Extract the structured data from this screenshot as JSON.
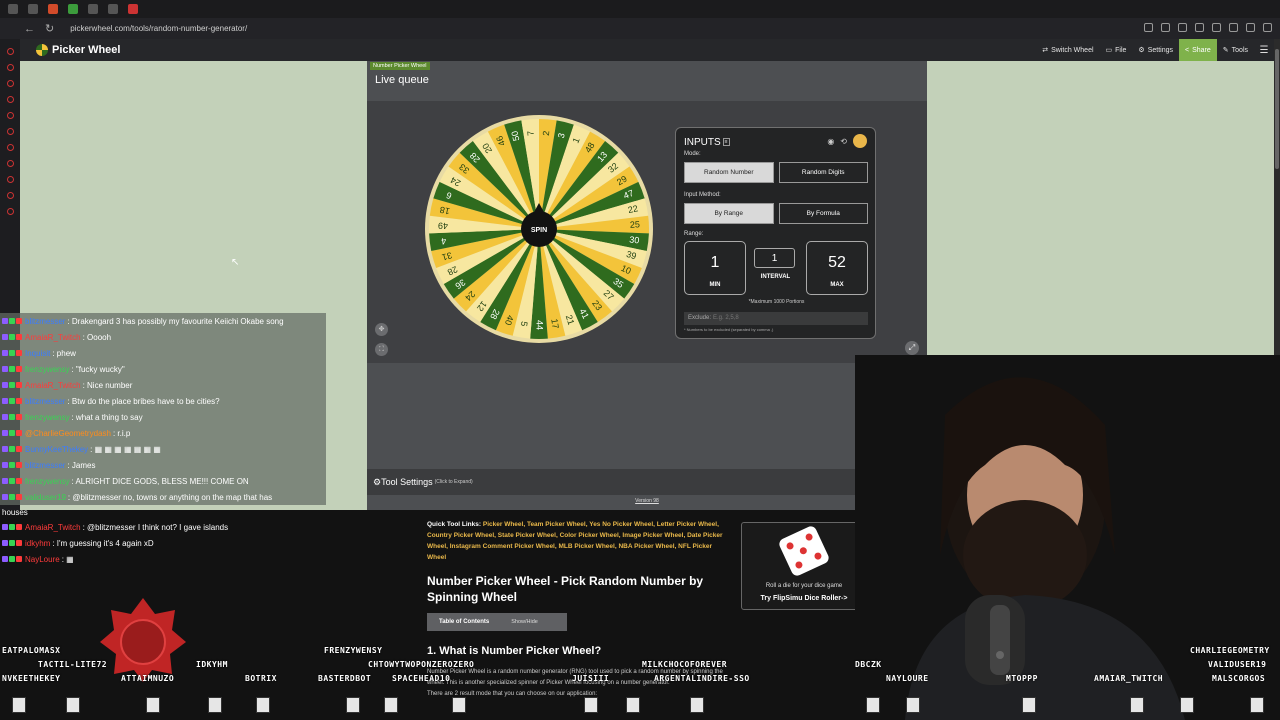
{
  "browser": {
    "url": "pickerwheel.com/tools/random-number-generator/",
    "back": "←",
    "reload": "↻"
  },
  "header": {
    "brand": "Picker Wheel",
    "nav": [
      "Switch Wheel",
      "File",
      "Settings",
      "Share",
      "Tools"
    ],
    "menu_icon": "☰"
  },
  "tool": {
    "tag": "Number Picker Wheel",
    "title": "Live queue",
    "spin_label": "SPIN",
    "wheel_numbers": [
      "2",
      "3",
      "1",
      "48",
      "13",
      "32",
      "29",
      "47",
      "22",
      "25",
      "30",
      "39",
      "10",
      "35",
      "27",
      "23",
      "41",
      "21",
      "17",
      "44",
      "5",
      "40",
      "28",
      "12",
      "24",
      "36",
      "28",
      "31",
      "4",
      "49",
      "18",
      "6",
      "24",
      "33",
      "28",
      "20",
      "46",
      "50",
      "7"
    ],
    "inputs": {
      "title": "INPUTS",
      "mode_label": "Mode:",
      "mode_options": [
        "Random Number",
        "Random Digits"
      ],
      "method_label": "Input Method:",
      "method_options": [
        "By Range",
        "By Formula"
      ],
      "range_label": "Range:",
      "min": "1",
      "min_caption": "MIN",
      "interval": "1",
      "interval_caption": "INTERVAL",
      "max": "52",
      "max_caption": "MAX",
      "max_note": "*Maximum 1000 Portions",
      "exclude_label": "Exclude:",
      "exclude_placeholder": "E.g. 2,5,8",
      "exclude_note": "* Numbers to be excluded (separated by comma ,)"
    },
    "settings_label": "Tool Settings",
    "settings_hint": "(Click to Expand)",
    "version": "Version 98"
  },
  "chat": [
    {
      "user": "blitzmesser",
      "color": "#3b7cff",
      "text": ": Drakengard 3 has possibly my favourite Keiichi Okabe song"
    },
    {
      "user": "AmaiaR_Twitch",
      "color": "#ff3b3b",
      "text": ": Ooooh"
    },
    {
      "user": "Inquisit",
      "color": "#3b7cff",
      "text": ": phew"
    },
    {
      "user": "frenzywensy",
      "color": "#39d353",
      "text": ": \"fucky wucky\""
    },
    {
      "user": "AmaiaR_Twitch",
      "color": "#ff3b3b",
      "text": ": Nice number"
    },
    {
      "user": "blitzmesser",
      "color": "#3b7cff",
      "text": ": Btw do the place bribes have to be cities?"
    },
    {
      "user": "frenzywensy",
      "color": "#39d353",
      "text": ": what a thing to say"
    },
    {
      "user": "@CharlieGeometrydash",
      "color": "#ff8c1a",
      "text": ": r.i.p"
    },
    {
      "user": "BunnyKeeThekey",
      "color": "#3b7cff",
      "text": ": ▦ ▦ ▦ ▦ ▦ ▦ ▦"
    },
    {
      "user": "blitzmesser",
      "color": "#3b7cff",
      "text": ": James"
    },
    {
      "user": "frenzywensy",
      "color": "#39d353",
      "text": ": ALRIGHT DICE GODS, BLESS ME!!! COME ON"
    },
    {
      "user": "validuser19",
      "color": "#39d353",
      "text": ": @blitzmesser no, towns or anything on the map that has"
    },
    {
      "user": "AmaiaR_Twitch",
      "color": "#ff3b3b",
      "text": ": @blitzmesser I think not? I gave islands"
    },
    {
      "user": "idkyhm",
      "color": "#ff3b3b",
      "text": ": I'm guessing it's 4 again xD"
    },
    {
      "user": "NayLoure",
      "color": "#ff3b3b",
      "text": ": ▦"
    }
  ],
  "chat_wrap": "houses",
  "article": {
    "quick_links_label": "Quick Tool Links:",
    "quick_links": "Picker Wheel, Team Picker Wheel, Yes No Picker Wheel, Letter Picker Wheel, Country Picker Wheel, State Picker Wheel, Color Picker Wheel, Image Picker Wheel, Date Picker Wheel, Instagram Comment Picker Wheel, MLB Picker Wheel, NBA Picker Wheel, NFL Picker Wheel",
    "title": "Number Picker Wheel - Pick Random Number by Spinning Wheel",
    "toc": "Table of Contents",
    "toc_toggle": "Show/Hide",
    "section": "1. What is Number Picker Wheel?",
    "p1": "Number Picker Wheel is a random number generator (RNG) tool used to pick a random number by spinning the wheel. This is another specialized spinner of Picker Wheel focusing on a number generator.",
    "p2": "There are 2 result mode that you can choose on our application:"
  },
  "dice_card": {
    "caption": "Roll a die for your dice game",
    "link": "Try FlipSimu Dice Roller->"
  },
  "overlay_names": [
    "EATPALOMASX",
    "TACTIL-LITE72",
    "IDKYHM",
    "FRENZYWENSY",
    "CHTOWYTWOPONZEROZERO",
    "MILKCHOCOFOREVER",
    "DBCZK",
    "CHARLIEGEOMETRY",
    "NVKEETHEKEY",
    "ATTAIMNUZO",
    "BOTRIX",
    "BASTERDBOT",
    "SPACEHEAD10",
    "JUISIII",
    "ARGENTALINDIRE-SSO",
    "NAYLOURE",
    "MTOPPP",
    "AMAIAR_TWITCH",
    "VALIDUSER19",
    "MALSCORGOS"
  ],
  "colors": {
    "wheel_yellow": "#f3c43a",
    "wheel_green": "#2f6b1e",
    "wheel_light": "#f7e7a0",
    "accent": "#7fb24b"
  }
}
